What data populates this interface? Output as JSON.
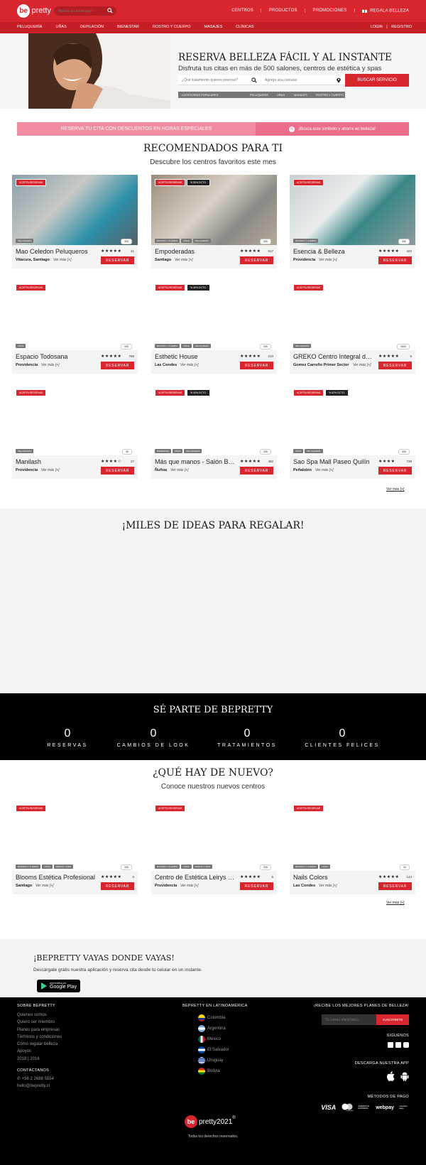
{
  "header": {
    "logo_be": "be",
    "logo_text": "pretty",
    "search_placeholder": "Busca un local aquí",
    "nav": [
      "CENTROS",
      "PRODUCTOS",
      "PROMOCIONES"
    ],
    "gift_label": "REGALA BELLEZA"
  },
  "categories": [
    "PELUQUERÍA",
    "UÑAS",
    "DEPILACIÓN",
    "BIENESTAR",
    "ROSTRO Y CUERPO",
    "MASAJES",
    "CLÍNICAS"
  ],
  "auth": {
    "login": "LOGIN",
    "sep": "|",
    "register": "REGISTRO"
  },
  "hero": {
    "title": "RESERVA BELLEZA FÁCIL Y AL INSTANTE",
    "subtitle": "Disfruta tus citas en más de 500 salones, centros de estética y spas",
    "treatment_placeholder": "¿Qué tratamiento quieres reservar?",
    "comuna_placeholder": "Agrega una comuna",
    "button": "BUSCAR SERVICIO",
    "popular_label": "CATEGORÍAS POPULARES",
    "popular": [
      "PELUQUERÍA",
      "UÑAS",
      "MASAJES",
      "ROSTRO Y CUERPO"
    ]
  },
  "promo": {
    "left": "RESERVA TU CITA CON DESCUENTOS EN HORAS ESPECIALES",
    "right": "¡Busca este símbolo y ahorra en belleza!",
    "symbol": "%"
  },
  "recommended": {
    "title": "RECOMENDADOS PARA TI",
    "subtitle": "Descubre los centros favoritos este mes",
    "ver_mas": "Ver más [+]",
    "cards": [
      {
        "name": "Mao Celedon Peluqueros",
        "stars": "★★★★★",
        "count": "21",
        "location": "Vitacura, Santiago",
        "ver": "Ver más [+]",
        "badge": "ACEPTA RESERVAS",
        "discount": "",
        "tags": [
          "PELUQUERÍA"
        ],
        "price": "$$$",
        "reserve": "RESERVAR"
      },
      {
        "name": "Empoderadas",
        "stars": "★★★★★",
        "count": "517",
        "location": "Santiago",
        "ver": "Ver más [+]",
        "badge": "ACEPTA RESERVAS",
        "discount": "% 50% DCTO.",
        "tags": [
          "ROSTRO Y CUERPO",
          "UÑAS",
          "PELUQUERÍA"
        ],
        "price": "$$$",
        "reserve": "RESERVAR"
      },
      {
        "name": "Esencia & Belleza",
        "stars": "★★★★★",
        "count": "422",
        "location": "Providencia",
        "ver": "Ver más [+]",
        "badge": "ACEPTA RESERVAS",
        "discount": "",
        "tags": [
          "ROSTRO Y CUERPO"
        ],
        "price": "$$$",
        "reserve": "RESERVAR"
      },
      {
        "name": "Espacio Todosana",
        "stars": "★★★★★",
        "count": "785",
        "location": "Providencia",
        "ver": "Ver más [+]",
        "badge": "ACEPTA RESERVAS",
        "discount": "",
        "tags": [
          "UÑAS"
        ],
        "price": "$$$",
        "reserve": "RESERVAR"
      },
      {
        "name": "Esthetic House",
        "stars": "★★★★★",
        "count": "210",
        "location": "Las Condes",
        "ver": "Ver más [+]",
        "badge": "ACEPTA RESERVAS",
        "discount": "% 40% DCTO.",
        "tags": [
          "ROSTRO Y CUERPO",
          "UÑAS",
          "PELUQUERÍA"
        ],
        "price": "$$$",
        "reserve": "RESERVAR"
      },
      {
        "name": "GREKO Centro Integral de Estética",
        "stars": "★★★★★",
        "count": "5",
        "location": "Gomez Carreño Primer Sector",
        "ver": "Ver más [+]",
        "badge": "ACEPTA RESERVAS",
        "discount": "",
        "tags": [
          "PELUQUERÍA"
        ],
        "price": "$$$$",
        "reserve": "RESERVAR"
      },
      {
        "name": "Manilash",
        "stars": "★★★★☆",
        "count": "27",
        "location": "Providencia",
        "ver": "Ver más [+]",
        "badge": "ACEPTA RESERVAS",
        "discount": "",
        "tags": [
          "PELUQUERÍA"
        ],
        "price": "$$",
        "reserve": "RESERVAR"
      },
      {
        "name": "Más que manos - Salón Boutique",
        "stars": "★★★★★",
        "count": "482",
        "location": "Ñuñoa",
        "ver": "Ver más [+]",
        "badge": "ACEPTA RESERVAS",
        "discount": "% 40% DCTO.",
        "tags": [
          "BIENESTAR",
          "UÑAS",
          "PELUQUERÍA"
        ],
        "price": "$$$",
        "reserve": "RESERVAR"
      },
      {
        "name": "Sao Spa Mall Paseo Quilín",
        "stars": "★★★★",
        "count": "739",
        "location": "Peñalolen",
        "ver": "Ver más [+]",
        "badge": "ACEPTA RESERVAS",
        "discount": "% 62% DCTO.",
        "tags": [
          "UÑAS",
          "PELUQUERÍA"
        ],
        "price": "$$$",
        "reserve": "RESERVAR"
      }
    ]
  },
  "ideas": {
    "title": "¡MILES DE IDEAS PARA REGALAR!"
  },
  "stats": {
    "title": "SÉ PARTE DE BEPRETTY",
    "items": [
      {
        "n": "0",
        "l": "RESERVAS"
      },
      {
        "n": "0",
        "l": "CAMBIOS DE LOOK"
      },
      {
        "n": "0",
        "l": "TRATAMIENTOS"
      },
      {
        "n": "0",
        "l": "CLIENTES FELICES"
      }
    ]
  },
  "new": {
    "title": "¿QUÉ HAY DE NUEVO?",
    "subtitle": "Conoce nuestros nuevos centros",
    "ver_mas": "Ver más [+]",
    "cards": [
      {
        "name": "Blooms Estética Profesional",
        "stars": "★★★★★",
        "count": "0",
        "location": "Santiago",
        "ver": "Ver más [+]",
        "badge": "ACEPTA RESERVAS",
        "discount": "",
        "tags": [
          "ROSTRO Y CUERPO",
          "UÑAS",
          "MANOS Y PIES"
        ],
        "price": "$$$",
        "reserve": "RESERVAR"
      },
      {
        "name": "Centro de Estética Leirys Spa",
        "stars": "★★★★★",
        "count": "5",
        "location": "Providencia",
        "ver": "Ver más [+]",
        "badge": "ACEPTA RESERVAS",
        "discount": "",
        "tags": [
          "ROSTRO Y CUERPO",
          "UÑAS",
          "MANOS Y PIES"
        ],
        "price": "$$$",
        "reserve": "RESERVAR"
      },
      {
        "name": "Nails Colors",
        "stars": "★★★★★",
        "count": "144",
        "location": "Las Condes",
        "ver": "Ver más [+]",
        "badge": "ACEPTA RESERVAS",
        "discount": "",
        "tags": [
          "ROSTRO Y CUERPO",
          "UÑAS"
        ],
        "price": "$$",
        "reserve": "RESERVAR"
      }
    ]
  },
  "app": {
    "title": "¡BEPRETTY VAYAS DONDE VAYAS!",
    "subtitle": "Descárgate gratis nuestra aplicación y reserva cita desde tu celular en un instante.",
    "gplay_small": "DISPONIBLE EN",
    "gplay_big": "Google Play"
  },
  "footer": {
    "about_title": "SOBRE BEPRETTY",
    "about_links": [
      "Quienes somos",
      "Quiero ser miembro",
      "Planes para empresas",
      "Términos y condiciones",
      "Cómo regalar belleza",
      "Apoyos",
      "2018 | 2016"
    ],
    "contact_title": "CONTÁCTANOS",
    "phone": "+56 2 2688 5554",
    "email": "hello@bepretty.cl",
    "latam_title": "BEPRETTY EN LATINOAMÉRICA",
    "countries": [
      "Colombia",
      "Argentina",
      "México",
      "El Salvador",
      "Uruguay",
      "Bolivia"
    ],
    "newsletter_title": "¡RECIBE LOS MEJORES PLANES DE BELLEZA!",
    "newsletter_placeholder": "Tu correo electrónico",
    "newsletter_button": "SUSCRIBETE",
    "follow": "SIGUENOS",
    "download": "DESCARGA NUESTRA APP",
    "payment": "MÉTODOS DE PAGO",
    "payments": [
      "VISA",
      "mastercard",
      "AMERICAN EXPRESS",
      "webpay",
      "mercado pago"
    ],
    "logo_be": "be",
    "logo_text": "pretty",
    "year": "2021",
    "reg": "®",
    "rights": "Todos los derechos reservados."
  },
  "colors": {
    "brand": "#d8262f",
    "promo_pink": "#f28ca1"
  }
}
